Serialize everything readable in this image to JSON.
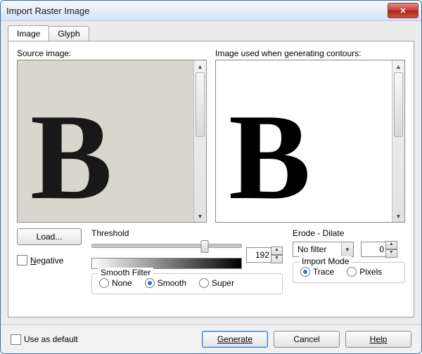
{
  "window": {
    "title": "Import Raster Image"
  },
  "tabs": {
    "image": "Image",
    "glyph": "Glyph"
  },
  "labels": {
    "source": "Source image:",
    "contour": "Image used when generating contours:"
  },
  "buttons": {
    "load": "Load...",
    "generate": "Generate",
    "cancel": "Cancel",
    "help": "Help"
  },
  "checkboxes": {
    "negative_u": "N",
    "negative_rest": "egative",
    "use_default": "Use as default"
  },
  "threshold": {
    "label": "Threshold",
    "value": "192"
  },
  "erode": {
    "label": "Erode - Dilate",
    "filter": "No filter",
    "amount": "0"
  },
  "smooth": {
    "label": "Smooth Filter",
    "none": "None",
    "smooth": "Smooth",
    "super": "Super",
    "selected": "smooth"
  },
  "import_mode": {
    "label": "Import Mode",
    "trace": "Trace",
    "pixels": "Pixels",
    "selected": "trace"
  },
  "glyph": "B"
}
